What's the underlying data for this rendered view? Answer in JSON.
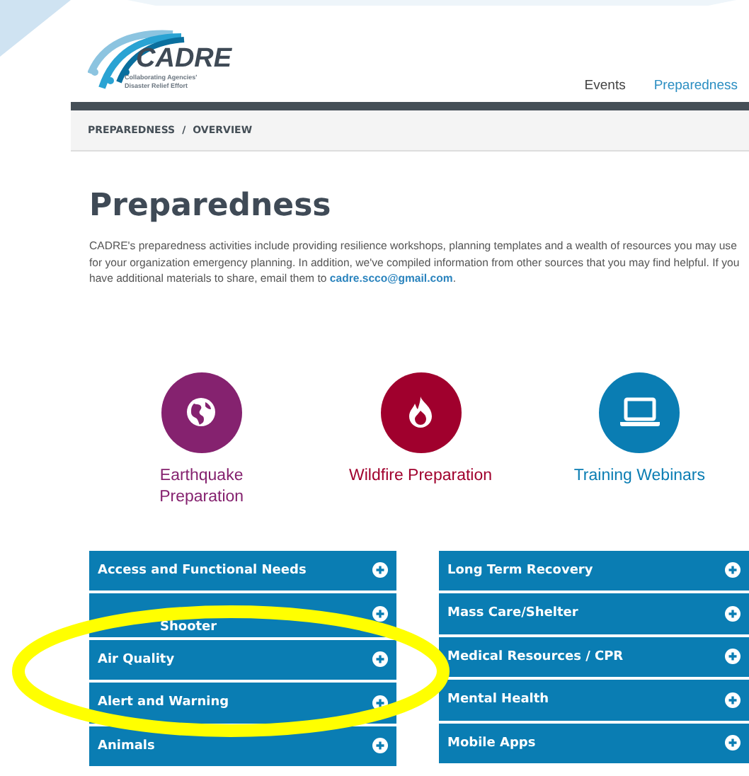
{
  "logo": {
    "name": "CADRE",
    "tagline": [
      "Collaborating Agencies'",
      "Disaster Relief Effort"
    ]
  },
  "nav": [
    {
      "label": "Events",
      "selected": false
    },
    {
      "label": "Preparedness",
      "selected": true
    }
  ],
  "breadcrumb": [
    "PREPAREDNESS",
    "/",
    "OVERVIEW"
  ],
  "title": "Preparedness",
  "intro": {
    "text": "CADRE's preparedness activities include providing resilience workshops, planning templates and a wealth of resources you may use for your organization emergency planning. In addition, we've compiled information from other sources that you may find helpful. If you have additional materials to share, email them to ",
    "link": "cadre.scco@gmail.com",
    "end": "."
  },
  "features": [
    {
      "kind": "globe",
      "label": "Earthquake Preparation",
      "color": "#85226f"
    },
    {
      "kind": "flame",
      "label": "Wildfire Preparation",
      "color": "#a0002d"
    },
    {
      "kind": "laptop",
      "label": "Training Webinars",
      "color": "#0a7db3"
    }
  ],
  "topics_left": [
    {
      "label": "Access and Functional Needs",
      "kind": "plain"
    },
    {
      "label": "Shooter",
      "kind": "covered"
    },
    {
      "label": "Air Quality",
      "kind": "plain"
    },
    {
      "label": "Alert and Warning",
      "kind": "plain"
    },
    {
      "label": "Animals",
      "kind": "plain"
    }
  ],
  "topics_right": [
    {
      "label": "Long Term Recovery",
      "kind": "plain"
    },
    {
      "label": "Mass Care/Shelter",
      "kind": "plain"
    },
    {
      "label": "Medical Resources / CPR",
      "kind": "plain"
    },
    {
      "label": "Mental Health",
      "kind": "plain"
    },
    {
      "label": "Mobile Apps",
      "kind": "plain"
    }
  ],
  "annotation": {
    "kind": "ellipse",
    "color": "#ffff00"
  }
}
